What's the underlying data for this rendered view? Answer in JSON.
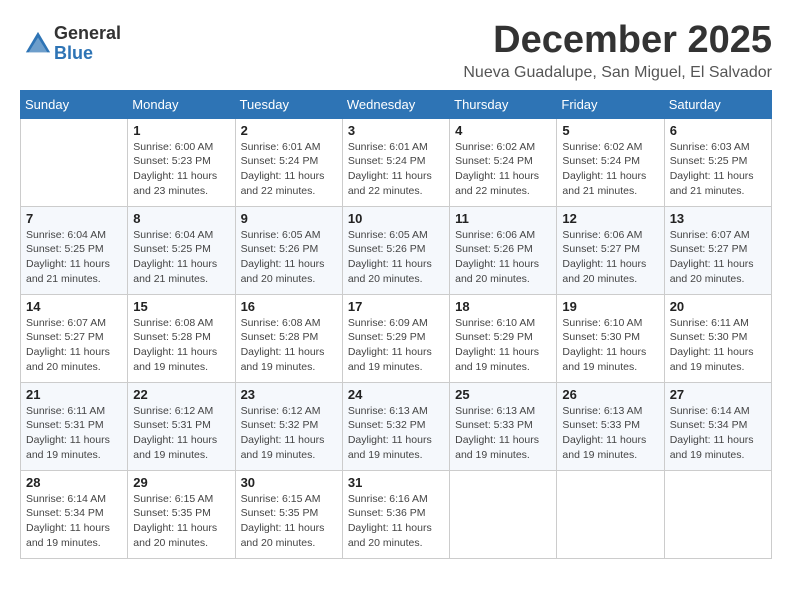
{
  "logo": {
    "general": "General",
    "blue": "Blue"
  },
  "title": "December 2025",
  "subtitle": "Nueva Guadalupe, San Miguel, El Salvador",
  "days_header": [
    "Sunday",
    "Monday",
    "Tuesday",
    "Wednesday",
    "Thursday",
    "Friday",
    "Saturday"
  ],
  "weeks": [
    [
      {
        "num": "",
        "sunrise": "",
        "sunset": "",
        "daylight": ""
      },
      {
        "num": "1",
        "sunrise": "Sunrise: 6:00 AM",
        "sunset": "Sunset: 5:23 PM",
        "daylight": "Daylight: 11 hours and 23 minutes."
      },
      {
        "num": "2",
        "sunrise": "Sunrise: 6:01 AM",
        "sunset": "Sunset: 5:24 PM",
        "daylight": "Daylight: 11 hours and 22 minutes."
      },
      {
        "num": "3",
        "sunrise": "Sunrise: 6:01 AM",
        "sunset": "Sunset: 5:24 PM",
        "daylight": "Daylight: 11 hours and 22 minutes."
      },
      {
        "num": "4",
        "sunrise": "Sunrise: 6:02 AM",
        "sunset": "Sunset: 5:24 PM",
        "daylight": "Daylight: 11 hours and 22 minutes."
      },
      {
        "num": "5",
        "sunrise": "Sunrise: 6:02 AM",
        "sunset": "Sunset: 5:24 PM",
        "daylight": "Daylight: 11 hours and 21 minutes."
      },
      {
        "num": "6",
        "sunrise": "Sunrise: 6:03 AM",
        "sunset": "Sunset: 5:25 PM",
        "daylight": "Daylight: 11 hours and 21 minutes."
      }
    ],
    [
      {
        "num": "7",
        "sunrise": "Sunrise: 6:04 AM",
        "sunset": "Sunset: 5:25 PM",
        "daylight": "Daylight: 11 hours and 21 minutes."
      },
      {
        "num": "8",
        "sunrise": "Sunrise: 6:04 AM",
        "sunset": "Sunset: 5:25 PM",
        "daylight": "Daylight: 11 hours and 21 minutes."
      },
      {
        "num": "9",
        "sunrise": "Sunrise: 6:05 AM",
        "sunset": "Sunset: 5:26 PM",
        "daylight": "Daylight: 11 hours and 20 minutes."
      },
      {
        "num": "10",
        "sunrise": "Sunrise: 6:05 AM",
        "sunset": "Sunset: 5:26 PM",
        "daylight": "Daylight: 11 hours and 20 minutes."
      },
      {
        "num": "11",
        "sunrise": "Sunrise: 6:06 AM",
        "sunset": "Sunset: 5:26 PM",
        "daylight": "Daylight: 11 hours and 20 minutes."
      },
      {
        "num": "12",
        "sunrise": "Sunrise: 6:06 AM",
        "sunset": "Sunset: 5:27 PM",
        "daylight": "Daylight: 11 hours and 20 minutes."
      },
      {
        "num": "13",
        "sunrise": "Sunrise: 6:07 AM",
        "sunset": "Sunset: 5:27 PM",
        "daylight": "Daylight: 11 hours and 20 minutes."
      }
    ],
    [
      {
        "num": "14",
        "sunrise": "Sunrise: 6:07 AM",
        "sunset": "Sunset: 5:27 PM",
        "daylight": "Daylight: 11 hours and 20 minutes."
      },
      {
        "num": "15",
        "sunrise": "Sunrise: 6:08 AM",
        "sunset": "Sunset: 5:28 PM",
        "daylight": "Daylight: 11 hours and 19 minutes."
      },
      {
        "num": "16",
        "sunrise": "Sunrise: 6:08 AM",
        "sunset": "Sunset: 5:28 PM",
        "daylight": "Daylight: 11 hours and 19 minutes."
      },
      {
        "num": "17",
        "sunrise": "Sunrise: 6:09 AM",
        "sunset": "Sunset: 5:29 PM",
        "daylight": "Daylight: 11 hours and 19 minutes."
      },
      {
        "num": "18",
        "sunrise": "Sunrise: 6:10 AM",
        "sunset": "Sunset: 5:29 PM",
        "daylight": "Daylight: 11 hours and 19 minutes."
      },
      {
        "num": "19",
        "sunrise": "Sunrise: 6:10 AM",
        "sunset": "Sunset: 5:30 PM",
        "daylight": "Daylight: 11 hours and 19 minutes."
      },
      {
        "num": "20",
        "sunrise": "Sunrise: 6:11 AM",
        "sunset": "Sunset: 5:30 PM",
        "daylight": "Daylight: 11 hours and 19 minutes."
      }
    ],
    [
      {
        "num": "21",
        "sunrise": "Sunrise: 6:11 AM",
        "sunset": "Sunset: 5:31 PM",
        "daylight": "Daylight: 11 hours and 19 minutes."
      },
      {
        "num": "22",
        "sunrise": "Sunrise: 6:12 AM",
        "sunset": "Sunset: 5:31 PM",
        "daylight": "Daylight: 11 hours and 19 minutes."
      },
      {
        "num": "23",
        "sunrise": "Sunrise: 6:12 AM",
        "sunset": "Sunset: 5:32 PM",
        "daylight": "Daylight: 11 hours and 19 minutes."
      },
      {
        "num": "24",
        "sunrise": "Sunrise: 6:13 AM",
        "sunset": "Sunset: 5:32 PM",
        "daylight": "Daylight: 11 hours and 19 minutes."
      },
      {
        "num": "25",
        "sunrise": "Sunrise: 6:13 AM",
        "sunset": "Sunset: 5:33 PM",
        "daylight": "Daylight: 11 hours and 19 minutes."
      },
      {
        "num": "26",
        "sunrise": "Sunrise: 6:13 AM",
        "sunset": "Sunset: 5:33 PM",
        "daylight": "Daylight: 11 hours and 19 minutes."
      },
      {
        "num": "27",
        "sunrise": "Sunrise: 6:14 AM",
        "sunset": "Sunset: 5:34 PM",
        "daylight": "Daylight: 11 hours and 19 minutes."
      }
    ],
    [
      {
        "num": "28",
        "sunrise": "Sunrise: 6:14 AM",
        "sunset": "Sunset: 5:34 PM",
        "daylight": "Daylight: 11 hours and 19 minutes."
      },
      {
        "num": "29",
        "sunrise": "Sunrise: 6:15 AM",
        "sunset": "Sunset: 5:35 PM",
        "daylight": "Daylight: 11 hours and 20 minutes."
      },
      {
        "num": "30",
        "sunrise": "Sunrise: 6:15 AM",
        "sunset": "Sunset: 5:35 PM",
        "daylight": "Daylight: 11 hours and 20 minutes."
      },
      {
        "num": "31",
        "sunrise": "Sunrise: 6:16 AM",
        "sunset": "Sunset: 5:36 PM",
        "daylight": "Daylight: 11 hours and 20 minutes."
      },
      {
        "num": "",
        "sunrise": "",
        "sunset": "",
        "daylight": ""
      },
      {
        "num": "",
        "sunrise": "",
        "sunset": "",
        "daylight": ""
      },
      {
        "num": "",
        "sunrise": "",
        "sunset": "",
        "daylight": ""
      }
    ]
  ]
}
